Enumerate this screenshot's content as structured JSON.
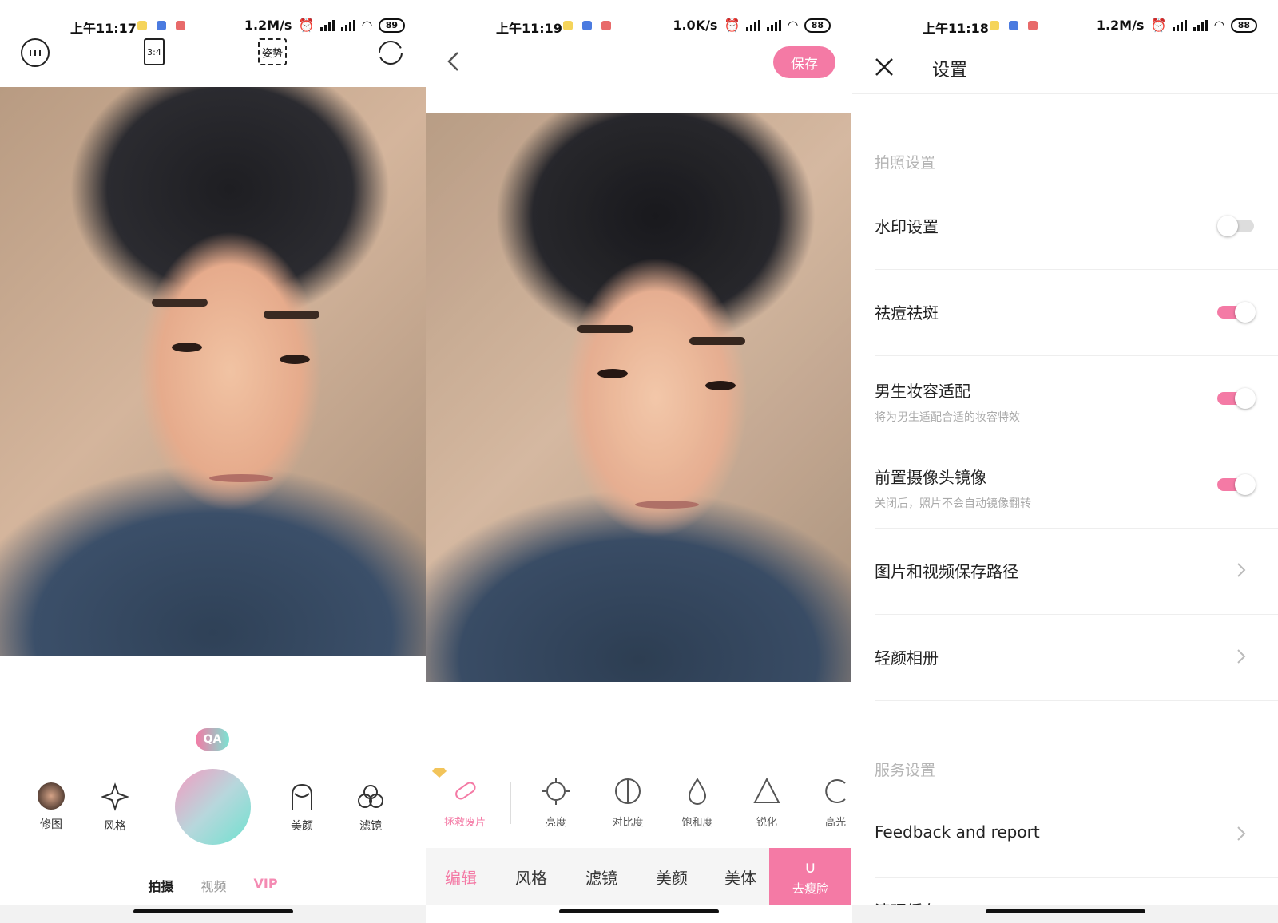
{
  "colors": {
    "accent": "#f47aa5",
    "teal": "#6fe1cf",
    "muted": "#b5b5b5"
  },
  "panel1": {
    "status": {
      "time": "上午11:17",
      "speed": "1.2M/s",
      "battery": "89"
    },
    "top_icons": {
      "ratio": "3:4",
      "pose": "姿势"
    },
    "qa_badge": "QA",
    "tools": {
      "retouch": "修图",
      "style": "风格",
      "beauty": "美颜",
      "filter": "滤镜"
    },
    "modes": {
      "photo": "拍摄",
      "video": "视频",
      "vip": "VIP"
    }
  },
  "panel2": {
    "status": {
      "time": "上午11:19",
      "speed": "1.0K/s",
      "battery": "88"
    },
    "save_label": "保存",
    "edit_tools": [
      {
        "label": "拯救废片",
        "icon": "bandage-icon"
      },
      {
        "label": "亮度",
        "icon": "sun-icon"
      },
      {
        "label": "对比度",
        "icon": "contrast-icon"
      },
      {
        "label": "饱和度",
        "icon": "drop-icon"
      },
      {
        "label": "锐化",
        "icon": "triangle-icon"
      },
      {
        "label": "高光",
        "icon": "highlight-icon"
      }
    ],
    "bottom_tabs": {
      "edit": "编辑",
      "style": "风格",
      "filter": "滤镜",
      "beauty": "美颜",
      "body": "美体",
      "slim": "去瘦脸"
    }
  },
  "panel3": {
    "status": {
      "time": "上午11:18",
      "speed": "1.2M/s",
      "battery": "88"
    },
    "title": "设置",
    "section_photo": "拍照设置",
    "rows": {
      "watermark": {
        "label": "水印设置",
        "on": false
      },
      "acne": {
        "label": "祛痘祛斑",
        "on": true
      },
      "male_makeup": {
        "label": "男生妆容适配",
        "desc": "将为男生适配合适的妆容特效",
        "on": true
      },
      "front_mirror": {
        "label": "前置摄像头镜像",
        "desc": "关闭后，照片不会自动镜像翻转",
        "on": true
      },
      "save_path": {
        "label": "图片和视频保存路径"
      },
      "album": {
        "label": "轻颜相册"
      }
    },
    "section_service": "服务设置",
    "feedback": "Feedback and report",
    "clear_cache": "清理缓存"
  }
}
